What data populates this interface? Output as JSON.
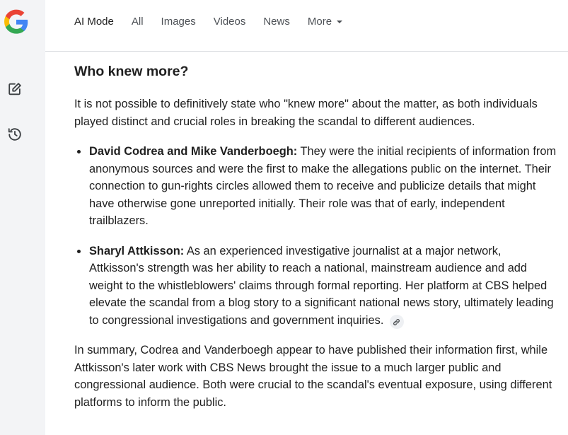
{
  "nav": {
    "tabs": [
      {
        "label": "AI Mode",
        "active": true
      },
      {
        "label": "All"
      },
      {
        "label": "Images"
      },
      {
        "label": "Videos"
      },
      {
        "label": "News"
      },
      {
        "label": "More"
      }
    ]
  },
  "rail": {
    "icons": [
      "google-logo",
      "new-chat-icon",
      "history-icon"
    ]
  },
  "answer": {
    "heading": "Who knew more?",
    "intro": "It is not possible to definitively state who \"knew more\" about the matter, as both individuals played distinct and crucial roles in breaking the scandal to different audiences.",
    "bullets": [
      {
        "title": "David Codrea and Mike Vanderboegh:",
        "text": "They were the initial recipients of information from anonymous sources and were the first to make the allegations public on the internet. Their connection to gun-rights circles allowed them to receive and publicize details that might have otherwise gone unreported initially. Their role was that of early, independent trailblazers."
      },
      {
        "title": "Sharyl Attkisson:",
        "text": "As an experienced investigative journalist at a major network, Attkisson's strength was her ability to reach a national, mainstream audience and add weight to the whistleblowers' claims through formal reporting. Her platform at CBS helped elevate the scandal from a blog story to a significant national news story, ultimately leading to congressional investigations and government inquiries."
      }
    ],
    "summary": "In summary, Codrea and Vanderboegh appear to have published their information first, while Attkisson's later work with CBS News brought the issue to a much larger public and congressional audience. Both were crucial to the scandal's eventual exposure, using different platforms to inform the public."
  },
  "colors": {
    "rail_bg": "#f3f4f6",
    "text": "#1f1f1f",
    "muted": "#4d5156",
    "divider": "#dadce0"
  }
}
